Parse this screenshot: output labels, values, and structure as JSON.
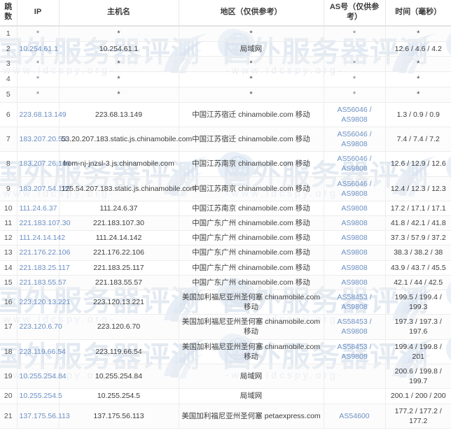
{
  "watermark": {
    "text": "国外服务器评测",
    "url": "-www.idcspy.org-",
    "color": "#cdd8e8"
  },
  "table": {
    "columns": [
      {
        "key": "hop",
        "label": "跳数"
      },
      {
        "key": "ip",
        "label": "IP"
      },
      {
        "key": "host",
        "label": "主机名"
      },
      {
        "key": "region",
        "label": "地区（仅供参考）"
      },
      {
        "key": "asn",
        "label": "AS号（仅供参考）"
      },
      {
        "key": "time",
        "label": "时间（毫秒）"
      }
    ],
    "link_color": "#6b8fc4",
    "rows": [
      {
        "hop": "1",
        "ip": "*",
        "host": "*",
        "region": "*",
        "asn": "*",
        "time": "*",
        "ip_link": false,
        "asn_link": false
      },
      {
        "hop": "2",
        "ip": "10.254.61.1",
        "host": "10.254.61.1",
        "region": "局域网",
        "asn": "",
        "time": "12.6 / 4.6 / 4.2",
        "ip_link": true,
        "asn_link": false
      },
      {
        "hop": "3",
        "ip": "*",
        "host": "*",
        "region": "*",
        "asn": "*",
        "time": "*",
        "ip_link": false,
        "asn_link": false
      },
      {
        "hop": "4",
        "ip": "*",
        "host": "*",
        "region": "*",
        "asn": "*",
        "time": "*",
        "ip_link": false,
        "asn_link": false
      },
      {
        "hop": "5",
        "ip": "*",
        "host": "*",
        "region": "*",
        "asn": "*",
        "time": "*",
        "ip_link": false,
        "asn_link": false
      },
      {
        "hop": "6",
        "ip": "223.68.13.149",
        "host": "223.68.13.149",
        "region": "中国江苏宿迁 chinamobile.com 移动",
        "asn": "AS56046 / AS9808",
        "time": "1.3 / 0.9 / 0.9",
        "ip_link": true,
        "asn_link": true
      },
      {
        "hop": "7",
        "ip": "183.207.20.53",
        "host": "53.20.207.183.static.js.chinamobile.com",
        "region": "中国江苏宿迁 chinamobile.com 移动",
        "asn": "AS56046 / AS9808",
        "time": "7.4 / 7.4 / 7.2",
        "ip_link": true,
        "asn_link": true
      },
      {
        "hop": "8",
        "ip": "183.207.26.146",
        "host": "from-nj-jnzsl-3.js.chinamobile.com",
        "region": "中国江苏南京 chinamobile.com 移动",
        "asn": "AS56046 / AS9808",
        "time": "12.6 / 12.9 / 12.6",
        "ip_link": true,
        "asn_link": true
      },
      {
        "hop": "9",
        "ip": "183.207.54.125",
        "host": "125.54.207.183.static.js.chinamobile.com",
        "region": "中国江苏南京 chinamobile.com 移动",
        "asn": "AS56046 / AS9808",
        "time": "12.4 / 12.3 / 12.3",
        "ip_link": true,
        "asn_link": true
      },
      {
        "hop": "10",
        "ip": "111.24.6.37",
        "host": "111.24.6.37",
        "region": "中国江苏南京 chinamobile.com 移动",
        "asn": "AS9808",
        "time": "17.2 / 17.1 / 17.1",
        "ip_link": true,
        "asn_link": true
      },
      {
        "hop": "11",
        "ip": "221.183.107.30",
        "host": "221.183.107.30",
        "region": "中国广东广州 chinamobile.com 移动",
        "asn": "AS9808",
        "time": "41.8 / 42.1 / 41.8",
        "ip_link": true,
        "asn_link": true
      },
      {
        "hop": "12",
        "ip": "111.24.14.142",
        "host": "111.24.14.142",
        "region": "中国广东广州 chinamobile.com 移动",
        "asn": "AS9808",
        "time": "37.3 / 57.9 / 37.2",
        "ip_link": true,
        "asn_link": true
      },
      {
        "hop": "13",
        "ip": "221.176.22.106",
        "host": "221.176.22.106",
        "region": "中国广东广州 chinamobile.com 移动",
        "asn": "AS9808",
        "time": "38.3 / 38.2 / 38",
        "ip_link": true,
        "asn_link": true
      },
      {
        "hop": "14",
        "ip": "221.183.25.117",
        "host": "221.183.25.117",
        "region": "中国广东广州 chinamobile.com 移动",
        "asn": "AS9808",
        "time": "43.9 / 43.7 / 45.5",
        "ip_link": true,
        "asn_link": true
      },
      {
        "hop": "15",
        "ip": "221.183.55.57",
        "host": "221.183.55.57",
        "region": "中国广东广州 chinamobile.com 移动",
        "asn": "AS9808",
        "time": "42.1 / 44 / 42.5",
        "ip_link": true,
        "asn_link": true
      },
      {
        "hop": "16",
        "ip": "223.120.13.221",
        "host": "223.120.13.221",
        "region": "美国加利福尼亚州圣何塞 chinamobile.com 移动",
        "asn": "AS58453 / AS9808",
        "time": "199.5 / 199.4 / 199.3",
        "ip_link": true,
        "asn_link": true
      },
      {
        "hop": "17",
        "ip": "223.120.6.70",
        "host": "223.120.6.70",
        "region": "美国加利福尼亚州圣何塞 chinamobile.com 移动",
        "asn": "AS58453 / AS9808",
        "time": "197.3 / 197.3 / 197.6",
        "ip_link": true,
        "asn_link": true
      },
      {
        "hop": "18",
        "ip": "223.119.66.54",
        "host": "223.119.66.54",
        "region": "美国加利福尼亚州圣何塞 chinamobile.com 移动",
        "asn": "AS58453 / AS9808",
        "time": "199.4 / 199.8 / 201",
        "ip_link": true,
        "asn_link": true
      },
      {
        "hop": "19",
        "ip": "10.255.254.84",
        "host": "10.255.254.84",
        "region": "局域网",
        "asn": "",
        "time": "200.6 / 199.8 / 199.7",
        "ip_link": true,
        "asn_link": false
      },
      {
        "hop": "20",
        "ip": "10.255.254.5",
        "host": "10.255.254.5",
        "region": "局域网",
        "asn": "",
        "time": "200.1 / 200 / 200",
        "ip_link": true,
        "asn_link": false
      },
      {
        "hop": "21",
        "ip": "137.175.56.113",
        "host": "137.175.56.113",
        "region": "美国加利福尼亚州圣何塞 petaexpress.com",
        "asn": "AS54600",
        "time": "177.2 / 177.2 / 177.2",
        "ip_link": true,
        "asn_link": true
      }
    ]
  }
}
